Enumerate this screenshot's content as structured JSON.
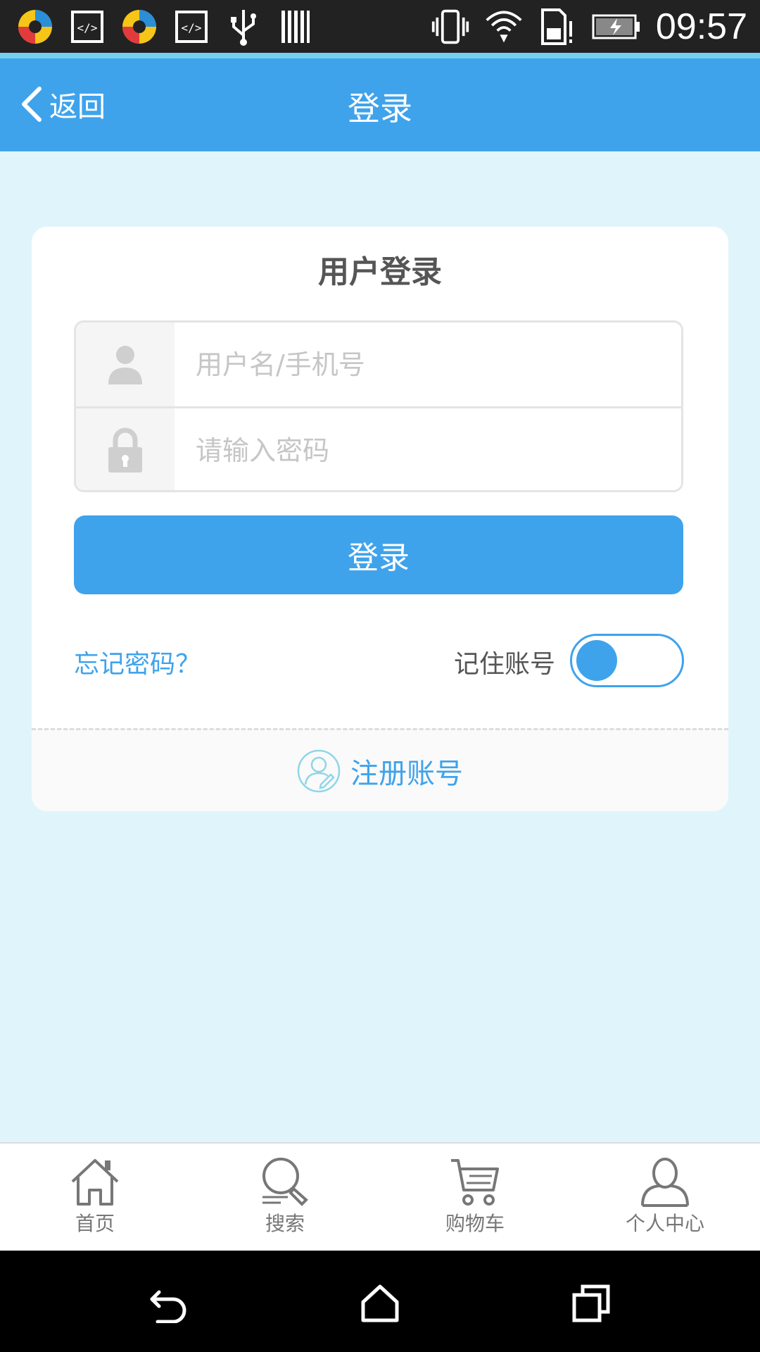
{
  "status_bar": {
    "time": "09:57",
    "left_icons": [
      "app-icon",
      "code-icon",
      "app-icon",
      "code-icon",
      "usb-icon",
      "barcode-icon"
    ],
    "right_icons": [
      "vibrate-icon",
      "wifi-icon",
      "sim-alert-icon",
      "battery-charging-icon"
    ]
  },
  "header": {
    "back_label": "返回",
    "title": "登录"
  },
  "login_card": {
    "title": "用户登录",
    "username_placeholder": "用户名/手机号",
    "password_placeholder": "请输入密码",
    "username_value": "",
    "password_value": "",
    "login_button": "登录",
    "forgot_password": "忘记密码？",
    "remember_label": "记住账号",
    "remember_on": false,
    "register_label": "注册账号"
  },
  "tabbar": {
    "items": [
      {
        "label": "首页",
        "icon": "home-icon"
      },
      {
        "label": "搜索",
        "icon": "search-icon"
      },
      {
        "label": "购物车",
        "icon": "cart-icon"
      },
      {
        "label": "个人中心",
        "icon": "user-icon"
      }
    ]
  },
  "colors": {
    "primary": "#3fa3ec",
    "page_bg": "#dff5fb",
    "status_bar": "#222222"
  }
}
